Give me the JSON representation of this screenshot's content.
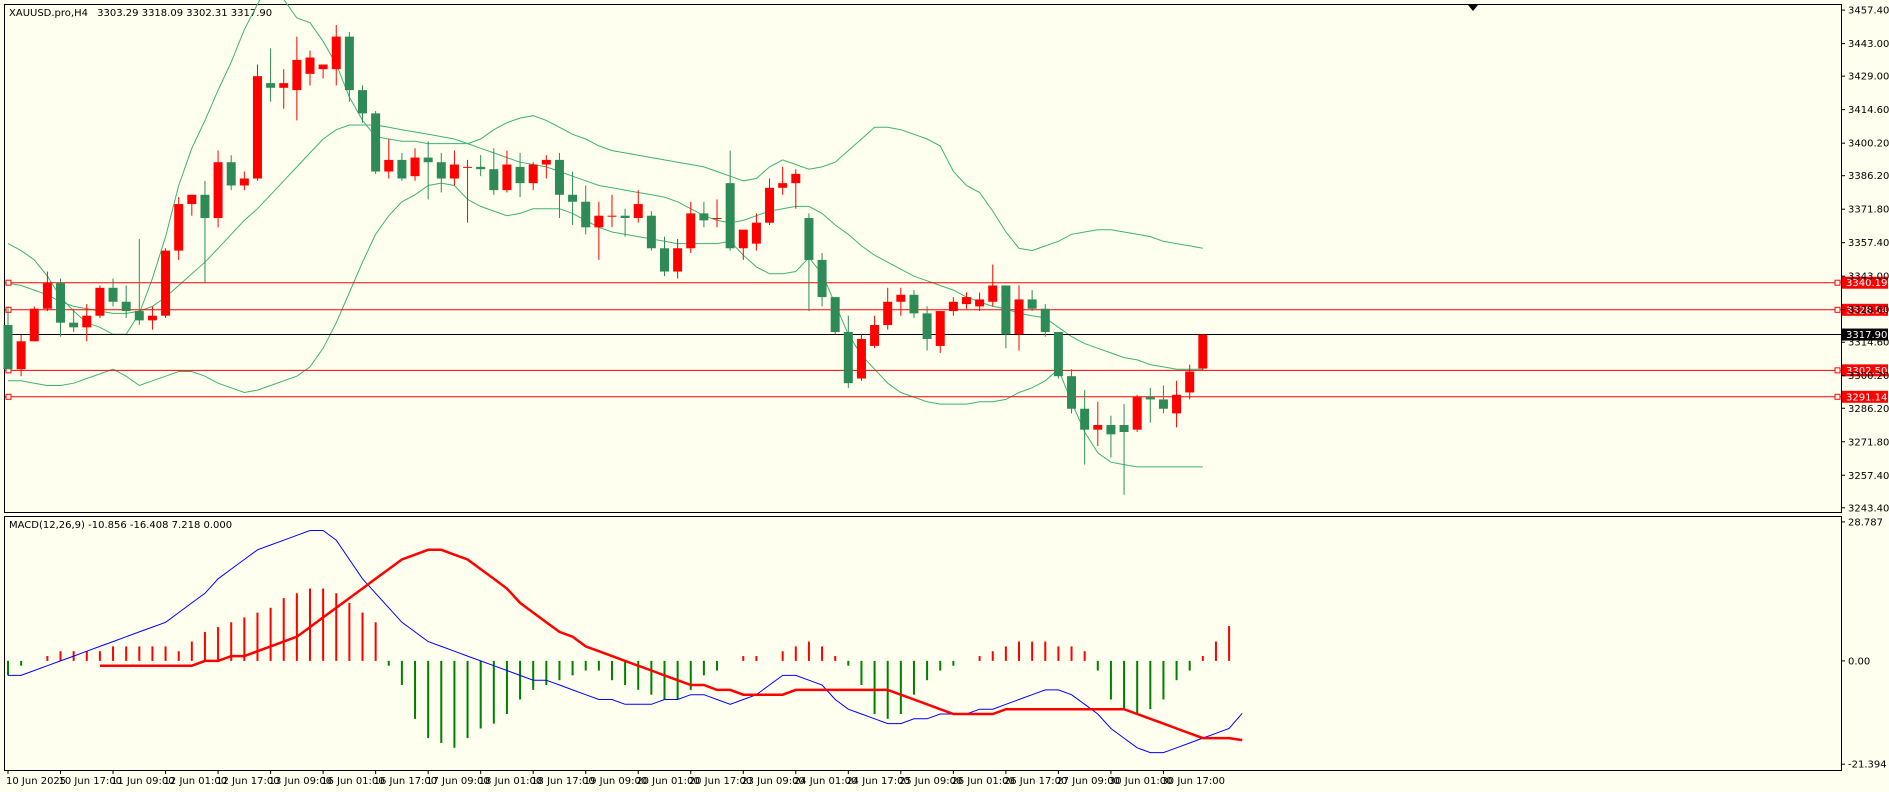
{
  "header": {
    "symbol": "XAUUSD.pro,H4",
    "ohlc": "3303.29 3318.09 3302.31 3317.90"
  },
  "colors": {
    "background": "#fffff0",
    "frame": "#000000",
    "bull": "#ff0000",
    "bear": "#2e8b57",
    "bands": "#3cb371",
    "level": "#ff0000",
    "price_line": "#000000",
    "macd_line": "#0000ff",
    "signal_line": "#ff0000",
    "hist_pos": "#ff0000",
    "hist_neg": "#008000",
    "label_text": "#ffffff"
  },
  "chart_data": [
    {
      "type": "candlestick",
      "title": "XAUUSD.pro,H4",
      "y_axis_ticks": [
        "3457.40",
        "3443.00",
        "3429.00",
        "3414.60",
        "3400.20",
        "3386.20",
        "3371.80",
        "3357.40",
        "3343.00",
        "3328.60",
        "3314.60",
        "3300.20",
        "3286.20",
        "3271.80",
        "3257.40",
        "3243.40"
      ],
      "ylim": [
        3241.6,
        3459.6
      ],
      "x_axis_ticks": [
        "10 Jun 2025",
        "10 Jun 17:00",
        "11 Jun 09:00",
        "12 Jun 01:00",
        "12 Jun 17:00",
        "13 Jun 09:00",
        "16 Jun 01:00",
        "16 Jun 17:00",
        "17 Jun 09:00",
        "18 Jun 01:00",
        "18 Jun 17:00",
        "19 Jun 09:00",
        "20 Jun 01:00",
        "20 Jun 17:00",
        "23 Jun 09:00",
        "24 Jun 01:00",
        "24 Jun 17:00",
        "25 Jun 09:00",
        "26 Jun 01:00",
        "26 Jun 17:00",
        "27 Jun 09:00",
        "30 Jun 01:00",
        "30 Jun 17:00"
      ],
      "candles": [
        {
          "o": 3322,
          "h": 3330,
          "l": 3303,
          "c": 3303
        },
        {
          "o": 3303,
          "h": 3318,
          "l": 3300,
          "c": 3315
        },
        {
          "o": 3315,
          "h": 3330,
          "l": 3315,
          "c": 3329
        },
        {
          "o": 3329,
          "h": 3345,
          "l": 3328,
          "c": 3340
        },
        {
          "o": 3340,
          "h": 3342,
          "l": 3317,
          "c": 3323
        },
        {
          "o": 3323,
          "h": 3329,
          "l": 3319,
          "c": 3321
        },
        {
          "o": 3321,
          "h": 3331,
          "l": 3315,
          "c": 3326
        },
        {
          "o": 3326,
          "h": 3339,
          "l": 3325,
          "c": 3338
        },
        {
          "o": 3338,
          "h": 3342,
          "l": 3330,
          "c": 3332
        },
        {
          "o": 3332,
          "h": 3339,
          "l": 3325,
          "c": 3328
        },
        {
          "o": 3328,
          "h": 3359,
          "l": 3322,
          "c": 3324
        },
        {
          "o": 3324,
          "h": 3330,
          "l": 3320,
          "c": 3326
        },
        {
          "o": 3326,
          "h": 3355,
          "l": 3325,
          "c": 3354
        },
        {
          "o": 3354,
          "h": 3377,
          "l": 3350,
          "c": 3374
        },
        {
          "o": 3374,
          "h": 3378,
          "l": 3369,
          "c": 3378
        },
        {
          "o": 3378,
          "h": 3384,
          "l": 3340,
          "c": 3368
        },
        {
          "o": 3368,
          "h": 3397,
          "l": 3364,
          "c": 3392
        },
        {
          "o": 3392,
          "h": 3395,
          "l": 3380,
          "c": 3382
        },
        {
          "o": 3382,
          "h": 3388,
          "l": 3380,
          "c": 3385
        },
        {
          "o": 3385,
          "h": 3434,
          "l": 3384,
          "c": 3429
        },
        {
          "o": 3426,
          "h": 3441,
          "l": 3418,
          "c": 3424
        },
        {
          "o": 3424,
          "h": 3432,
          "l": 3415,
          "c": 3426
        },
        {
          "o": 3423,
          "h": 3446,
          "l": 3410,
          "c": 3436
        },
        {
          "o": 3430,
          "h": 3440,
          "l": 3425,
          "c": 3437
        },
        {
          "o": 3432,
          "h": 3434,
          "l": 3428,
          "c": 3434
        },
        {
          "o": 3432,
          "h": 3451,
          "l": 3425,
          "c": 3446
        },
        {
          "o": 3446,
          "h": 3448,
          "l": 3418,
          "c": 3423
        },
        {
          "o": 3423,
          "h": 3425,
          "l": 3409,
          "c": 3413
        },
        {
          "o": 3413,
          "h": 3414,
          "l": 3387,
          "c": 3388
        },
        {
          "o": 3388,
          "h": 3402,
          "l": 3385,
          "c": 3393
        },
        {
          "o": 3393,
          "h": 3396,
          "l": 3384,
          "c": 3385
        },
        {
          "o": 3386,
          "h": 3398,
          "l": 3384,
          "c": 3394
        },
        {
          "o": 3394,
          "h": 3401,
          "l": 3376,
          "c": 3392
        },
        {
          "o": 3392,
          "h": 3396,
          "l": 3379,
          "c": 3385
        },
        {
          "o": 3385,
          "h": 3397,
          "l": 3382,
          "c": 3391
        },
        {
          "o": 3390,
          "h": 3393,
          "l": 3366,
          "c": 3390
        },
        {
          "o": 3390,
          "h": 3395,
          "l": 3386,
          "c": 3389
        },
        {
          "o": 3389,
          "h": 3398,
          "l": 3378,
          "c": 3380
        },
        {
          "o": 3380,
          "h": 3397,
          "l": 3379,
          "c": 3391
        },
        {
          "o": 3390,
          "h": 3396,
          "l": 3377,
          "c": 3383
        },
        {
          "o": 3383,
          "h": 3392,
          "l": 3380,
          "c": 3391
        },
        {
          "o": 3391,
          "h": 3395,
          "l": 3385,
          "c": 3393
        },
        {
          "o": 3393,
          "h": 3396,
          "l": 3368,
          "c": 3378
        },
        {
          "o": 3378,
          "h": 3388,
          "l": 3365,
          "c": 3375
        },
        {
          "o": 3375,
          "h": 3382,
          "l": 3361,
          "c": 3364
        },
        {
          "o": 3364,
          "h": 3375,
          "l": 3350,
          "c": 3369
        },
        {
          "o": 3369,
          "h": 3378,
          "l": 3364,
          "c": 3369
        },
        {
          "o": 3369,
          "h": 3372,
          "l": 3360,
          "c": 3368
        },
        {
          "o": 3368,
          "h": 3380,
          "l": 3366,
          "c": 3374
        },
        {
          "o": 3369,
          "h": 3371,
          "l": 3354,
          "c": 3355
        },
        {
          "o": 3355,
          "h": 3360,
          "l": 3343,
          "c": 3345
        },
        {
          "o": 3345,
          "h": 3359,
          "l": 3342,
          "c": 3355
        },
        {
          "o": 3355,
          "h": 3375,
          "l": 3353,
          "c": 3370
        },
        {
          "o": 3370,
          "h": 3375,
          "l": 3364,
          "c": 3367
        },
        {
          "o": 3368,
          "h": 3376,
          "l": 3364,
          "c": 3368
        },
        {
          "o": 3383,
          "h": 3397,
          "l": 3354,
          "c": 3355
        },
        {
          "o": 3355,
          "h": 3362,
          "l": 3350,
          "c": 3363
        },
        {
          "o": 3357,
          "h": 3370,
          "l": 3354,
          "c": 3366
        },
        {
          "o": 3366,
          "h": 3385,
          "l": 3365,
          "c": 3381
        },
        {
          "o": 3381,
          "h": 3390,
          "l": 3378,
          "c": 3383
        },
        {
          "o": 3383,
          "h": 3389,
          "l": 3372,
          "c": 3387
        },
        {
          "o": 3368,
          "h": 3370,
          "l": 3328,
          "c": 3350
        },
        {
          "o": 3350,
          "h": 3353,
          "l": 3330,
          "c": 3334
        },
        {
          "o": 3334,
          "h": 3328,
          "l": 3318,
          "c": 3319
        },
        {
          "o": 3319,
          "h": 3326,
          "l": 3295,
          "c": 3297
        },
        {
          "o": 3299,
          "h": 3318,
          "l": 3298,
          "c": 3316
        },
        {
          "o": 3313,
          "h": 3326,
          "l": 3312,
          "c": 3322
        },
        {
          "o": 3322,
          "h": 3338,
          "l": 3320,
          "c": 3332
        },
        {
          "o": 3332,
          "h": 3338,
          "l": 3326,
          "c": 3335
        },
        {
          "o": 3335,
          "h": 3337,
          "l": 3325,
          "c": 3327
        },
        {
          "o": 3327,
          "h": 3330,
          "l": 3311,
          "c": 3316
        },
        {
          "o": 3313,
          "h": 3327,
          "l": 3310,
          "c": 3328
        },
        {
          "o": 3328,
          "h": 3334,
          "l": 3326,
          "c": 3332
        },
        {
          "o": 3331,
          "h": 3336,
          "l": 3329,
          "c": 3334
        },
        {
          "o": 3330,
          "h": 3336,
          "l": 3328,
          "c": 3333
        },
        {
          "o": 3332,
          "h": 3348,
          "l": 3330,
          "c": 3339
        },
        {
          "o": 3339,
          "h": 3339,
          "l": 3312,
          "c": 3318
        },
        {
          "o": 3318,
          "h": 3339,
          "l": 3311,
          "c": 3333
        },
        {
          "o": 3333,
          "h": 3337,
          "l": 3328,
          "c": 3329
        },
        {
          "o": 3329,
          "h": 3331,
          "l": 3317,
          "c": 3319
        },
        {
          "o": 3319,
          "h": 3319,
          "l": 3299,
          "c": 3300
        },
        {
          "o": 3300,
          "h": 3303,
          "l": 3284,
          "c": 3286
        },
        {
          "o": 3286,
          "h": 3294,
          "l": 3262,
          "c": 3277
        },
        {
          "o": 3277,
          "h": 3289,
          "l": 3270,
          "c": 3279
        },
        {
          "o": 3279,
          "h": 3283,
          "l": 3265,
          "c": 3275
        },
        {
          "o": 3279,
          "h": 3288,
          "l": 3249,
          "c": 3276
        },
        {
          "o": 3277,
          "h": 3292,
          "l": 3276,
          "c": 3291
        },
        {
          "o": 3291,
          "h": 3295,
          "l": 3280,
          "c": 3290
        },
        {
          "o": 3290,
          "h": 3296,
          "l": 3284,
          "c": 3286
        },
        {
          "o": 3284,
          "h": 3298,
          "l": 3278,
          "c": 3292
        },
        {
          "o": 3293,
          "h": 3305,
          "l": 3290,
          "c": 3302
        },
        {
          "o": 3303.29,
          "h": 3318.09,
          "l": 3302.31,
          "c": 3317.9
        }
      ],
      "bollinger_upper": [
        3357,
        3354,
        3350,
        3343,
        3334,
        3328,
        3323,
        3321,
        3318,
        3318,
        3327,
        3342,
        3360,
        3382,
        3398,
        3410,
        3423,
        3435,
        3449,
        3460,
        3470,
        3462,
        3454,
        3452,
        3444,
        3434,
        3420,
        3410,
        3403,
        3402,
        3401,
        3401,
        3400,
        3400,
        3400,
        3400,
        3402,
        3406,
        3409,
        3411,
        3412,
        3410,
        3407,
        3404,
        3402,
        3399,
        3397,
        3396,
        3395,
        3394,
        3393,
        3392,
        3391,
        3390,
        3388,
        3386,
        3384,
        3385,
        3390,
        3393,
        3391,
        3389,
        3390,
        3392,
        3397,
        3402,
        3407,
        3407,
        3406,
        3404,
        3402,
        3399,
        3388,
        3382,
        3379,
        3371,
        3362,
        3355,
        3354,
        3356,
        3358,
        3361,
        3362,
        3363,
        3363,
        3362,
        3361,
        3360,
        3358,
        3357,
        3356,
        3355
      ],
      "bollinger_mid": [
        3340,
        3339,
        3337,
        3335,
        3332,
        3330,
        3329,
        3328,
        3327,
        3327,
        3328,
        3330,
        3334,
        3339,
        3344,
        3349,
        3355,
        3361,
        3367,
        3372,
        3378,
        3384,
        3390,
        3396,
        3402,
        3406,
        3408,
        3408,
        3408,
        3407,
        3406,
        3405,
        3404,
        3403,
        3402,
        3400,
        3398,
        3396,
        3394,
        3392,
        3391,
        3390,
        3388,
        3386,
        3384,
        3382,
        3381,
        3380,
        3379,
        3378,
        3377,
        3375,
        3372,
        3369,
        3367,
        3366,
        3367,
        3369,
        3371,
        3372,
        3373,
        3373,
        3370,
        3365,
        3361,
        3356,
        3352,
        3349,
        3346,
        3343,
        3341,
        3339,
        3337,
        3334,
        3332,
        3330,
        3329,
        3327,
        3326,
        3325,
        3321,
        3317,
        3314,
        3312,
        3310,
        3308,
        3307,
        3305,
        3304,
        3303,
        3303,
        3303
      ],
      "bollinger_lower": [
        3298,
        3298,
        3297,
        3296,
        3296,
        3297,
        3299,
        3301,
        3303,
        3300,
        3296,
        3298,
        3300,
        3302,
        3302,
        3300,
        3297,
        3295,
        3293,
        3294,
        3296,
        3298,
        3300,
        3304,
        3312,
        3323,
        3336,
        3349,
        3361,
        3369,
        3375,
        3378,
        3382,
        3383,
        3382,
        3376,
        3373,
        3371,
        3369,
        3370,
        3372,
        3372,
        3372,
        3370,
        3367,
        3364,
        3362,
        3361,
        3360,
        3359,
        3358,
        3357,
        3357,
        3357,
        3357,
        3358,
        3352,
        3347,
        3344,
        3344,
        3345,
        3351,
        3344,
        3331,
        3318,
        3309,
        3303,
        3297,
        3293,
        3291,
        3289,
        3288,
        3288,
        3288,
        3289,
        3289,
        3290,
        3293,
        3295,
        3298,
        3303,
        3289,
        3276,
        3267,
        3263,
        3262,
        3261,
        3261,
        3261,
        3261,
        3261,
        3261
      ],
      "levels": [
        {
          "value": 3340.19,
          "label": "3340.19"
        },
        {
          "value": 3328.54,
          "label": "3328.54"
        },
        {
          "value": 3302.5,
          "label": "3302.50"
        },
        {
          "value": 3291.14,
          "label": "3291.14"
        }
      ],
      "current_price": {
        "value": 3317.9,
        "label": "3317.90"
      }
    },
    {
      "type": "macd",
      "title": "MACD(12,26,9) -10.856 -16.408 7.218 0.000",
      "y_axis_ticks": [
        "28.787",
        "0.00",
        "-21.394"
      ],
      "ylim": [
        -22.6,
        29.8
      ],
      "histogram": [
        -3,
        -1,
        0,
        1,
        2,
        2,
        2,
        2,
        3,
        3,
        3,
        3,
        3,
        2,
        4,
        6,
        7,
        8,
        9,
        10,
        11,
        13,
        14,
        15,
        15,
        14,
        12,
        10,
        8,
        -1,
        -5,
        -12,
        -16,
        -17,
        -18,
        -16,
        -14,
        -13,
        -11,
        -8,
        -6,
        -5,
        -4,
        -3,
        -2,
        -2,
        -4,
        -5,
        -6,
        -7,
        -8,
        -8,
        -6,
        -3,
        -2,
        0,
        1,
        1,
        0,
        2,
        3,
        4,
        3,
        1,
        -1,
        -5,
        -11,
        -12,
        -11,
        -7,
        -4,
        -2,
        -1,
        0,
        1,
        2,
        3,
        4,
        4,
        4,
        3,
        3,
        2,
        -2,
        -8,
        -10,
        -11,
        -10,
        -8,
        -4,
        -2,
        1,
        4,
        7.218
      ],
      "macd": [
        -3,
        -3,
        -2,
        -1,
        0,
        1,
        2,
        3,
        4,
        5,
        6,
        7,
        8,
        10,
        12,
        14,
        17,
        19,
        21,
        23,
        24,
        25,
        26,
        27,
        27,
        25,
        21,
        17,
        14,
        11,
        8,
        6,
        4,
        3,
        2,
        1,
        0,
        -1,
        -2,
        -3,
        -4,
        -4,
        -5,
        -6,
        -7,
        -8,
        -8,
        -9,
        -9,
        -9,
        -8,
        -8,
        -7,
        -7,
        -8,
        -9,
        -8,
        -7,
        -5,
        -3,
        -3,
        -4,
        -5,
        -8,
        -10,
        -11,
        -12,
        -13,
        -13,
        -12,
        -12,
        -11,
        -11,
        -11,
        -10,
        -10,
        -9,
        -8,
        -7,
        -6,
        -6,
        -7,
        -9,
        -11,
        -14,
        -16,
        -18,
        -19,
        -19,
        -18,
        -17,
        -16,
        -15,
        -14,
        -10.856
      ],
      "signal": [
        -1,
        -1,
        -1,
        -1,
        -1,
        -1,
        -1,
        -1,
        0,
        0,
        1,
        1,
        2,
        3,
        4,
        5,
        7,
        9,
        11,
        13,
        15,
        17,
        19,
        21,
        22,
        23,
        23,
        22,
        21,
        19,
        17,
        15,
        12,
        10,
        8,
        6,
        5,
        3,
        2,
        1,
        0,
        -1,
        -2,
        -3,
        -4,
        -5,
        -5,
        -6,
        -6,
        -7,
        -7,
        -7,
        -7,
        -6,
        -6,
        -6,
        -6,
        -6,
        -6,
        -6,
        -6,
        -7,
        -8,
        -9,
        -10,
        -11,
        -11,
        -11,
        -11,
        -10,
        -10,
        -10,
        -10,
        -10,
        -10,
        -10,
        -10,
        -10,
        -10,
        -11,
        -12,
        -13,
        -14,
        -15,
        -16,
        -16,
        -16,
        -16.408
      ],
      "zero_label": "0.00"
    }
  ]
}
